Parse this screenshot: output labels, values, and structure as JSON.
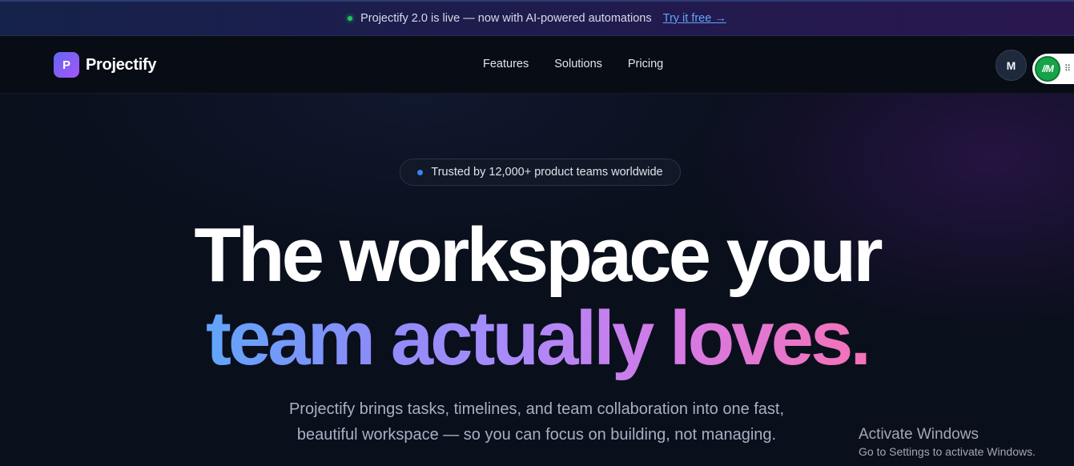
{
  "announcement": {
    "text": "Projectify 2.0 is live — now with AI-powered automations",
    "link_label": "Try it free →"
  },
  "nav": {
    "logo_letter": "P",
    "brand": "Projectify",
    "items": [
      {
        "label": "Features"
      },
      {
        "label": "Solutions"
      },
      {
        "label": "Pricing"
      }
    ],
    "avatar_initial": "M",
    "extension_label": "//M"
  },
  "hero": {
    "badge": "Trusted by 12,000+ product teams worldwide",
    "headline_line1": "The workspace your",
    "headline_line2": "team actually loves.",
    "subtitle_line1": "Projectify brings tasks, timelines, and team collaboration into one fast,",
    "subtitle_line2": "beautiful workspace — so you can focus on building, not managing."
  },
  "watermark": {
    "title": "Activate Windows",
    "subtitle": "Go to Settings to activate Windows."
  },
  "colors": {
    "announce_dot": "#22c55e",
    "link": "#60a5fa",
    "badge_dot": "#3b82f6",
    "gradient_start": "#60a5fa",
    "gradient_end": "#f472b6"
  }
}
